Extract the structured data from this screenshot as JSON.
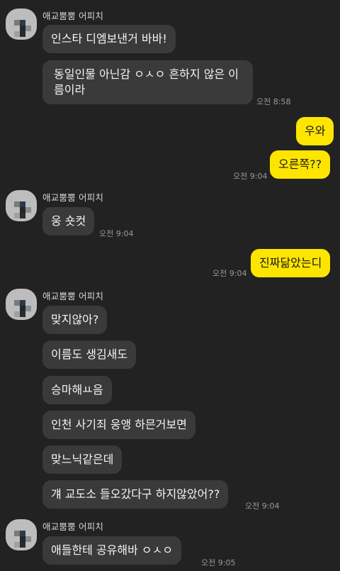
{
  "colors": {
    "background": "#222222",
    "incoming_bubble": "#3a3a3a",
    "outgoing_bubble": "#fee500",
    "timestamp": "#9a9a9a"
  },
  "sender": {
    "name": "애교뿜뿜 어피치"
  },
  "messages": [
    {
      "text": "인스타 디엠보낸거 바바!"
    },
    {
      "text": "동일인물 아닌감 ㅇㅅㅇ 흔하지 않은 이름이라",
      "time": "오전 8:58"
    },
    {
      "text": "우와"
    },
    {
      "text": "오른쪽??",
      "time": "오전 9:04"
    },
    {
      "text": "웅 숏컷",
      "time": "오전 9:04"
    },
    {
      "text": "진짜닮았는디",
      "time": "오전 9:04"
    },
    {
      "text": "맞지않아?"
    },
    {
      "text": "이름도 생김새도"
    },
    {
      "text": "승마해ㅛ음"
    },
    {
      "text": "인천 사기죄 웅앵 하믄거보면"
    },
    {
      "text": "맞느닉같은데"
    },
    {
      "text": "걔 교도소 들오갔다구 하지않았어??",
      "time": "오전 9:04"
    },
    {
      "text": "애들한테 공유해바 ㅇㅅㅇ",
      "time": "오전 9:05"
    }
  ]
}
